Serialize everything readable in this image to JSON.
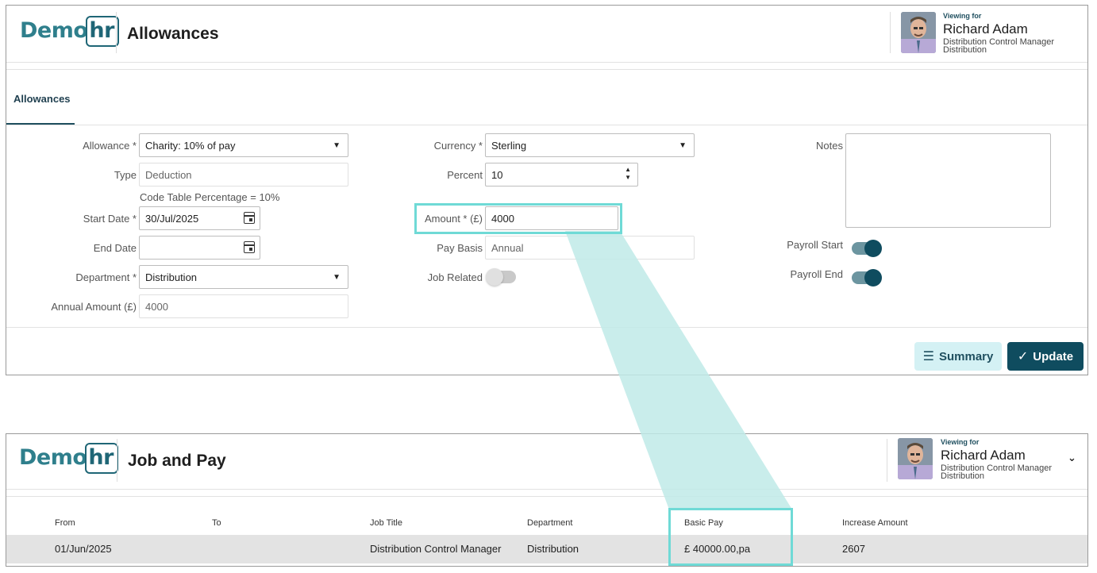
{
  "brand": {
    "logo_demo": "Demo",
    "logo_hr": "hr"
  },
  "user": {
    "viewing_for": "Viewing for",
    "name": "Richard Adam",
    "job_title": "Distribution Control Manager",
    "department": "Distribution"
  },
  "allowances_screen": {
    "title": "Allowances",
    "tab": "Allowances",
    "form": {
      "allowance": {
        "label": "Allowance *",
        "value": "Charity: 10% of pay"
      },
      "type": {
        "label": "Type",
        "value": "Deduction"
      },
      "code_table_note": "Code Table Percentage = 10%",
      "start_date": {
        "label": "Start Date *",
        "value": "30/Jul/2025"
      },
      "end_date": {
        "label": "End Date",
        "value": ""
      },
      "department": {
        "label": "Department *",
        "value": "Distribution"
      },
      "annual_amount": {
        "label": "Annual Amount (£)",
        "value": "4000"
      },
      "currency": {
        "label": "Currency *",
        "value": "Sterling"
      },
      "percent": {
        "label": "Percent",
        "value": "10"
      },
      "amount": {
        "label": "Amount * (£)",
        "value": "4000"
      },
      "pay_basis": {
        "label": "Pay Basis",
        "value": "Annual"
      },
      "job_related": {
        "label": "Job Related",
        "on": false
      },
      "notes": {
        "label": "Notes",
        "value": ""
      },
      "payroll_start": {
        "label": "Payroll Start",
        "on": true
      },
      "payroll_end": {
        "label": "Payroll End",
        "on": true
      }
    },
    "buttons": {
      "summary": "Summary",
      "update": "Update"
    }
  },
  "job_pay_screen": {
    "title": "Job and Pay",
    "columns": [
      "From",
      "To",
      "Job Title",
      "Department",
      "Basic Pay",
      "Increase Amount"
    ],
    "rows": [
      {
        "from": "01/Jun/2025",
        "to": "",
        "job_title": "Distribution Control Manager",
        "department": "Distribution",
        "basic_pay": "£ 40000.00,pa",
        "increase_amount": "2607"
      }
    ]
  },
  "colors": {
    "brand_teal": "#2f7f8c",
    "primary_dark": "#0f4c5f",
    "highlight": "#6fdad6",
    "callout_fill": "#bfeae7",
    "summary_bg": "#d4f1f4"
  }
}
